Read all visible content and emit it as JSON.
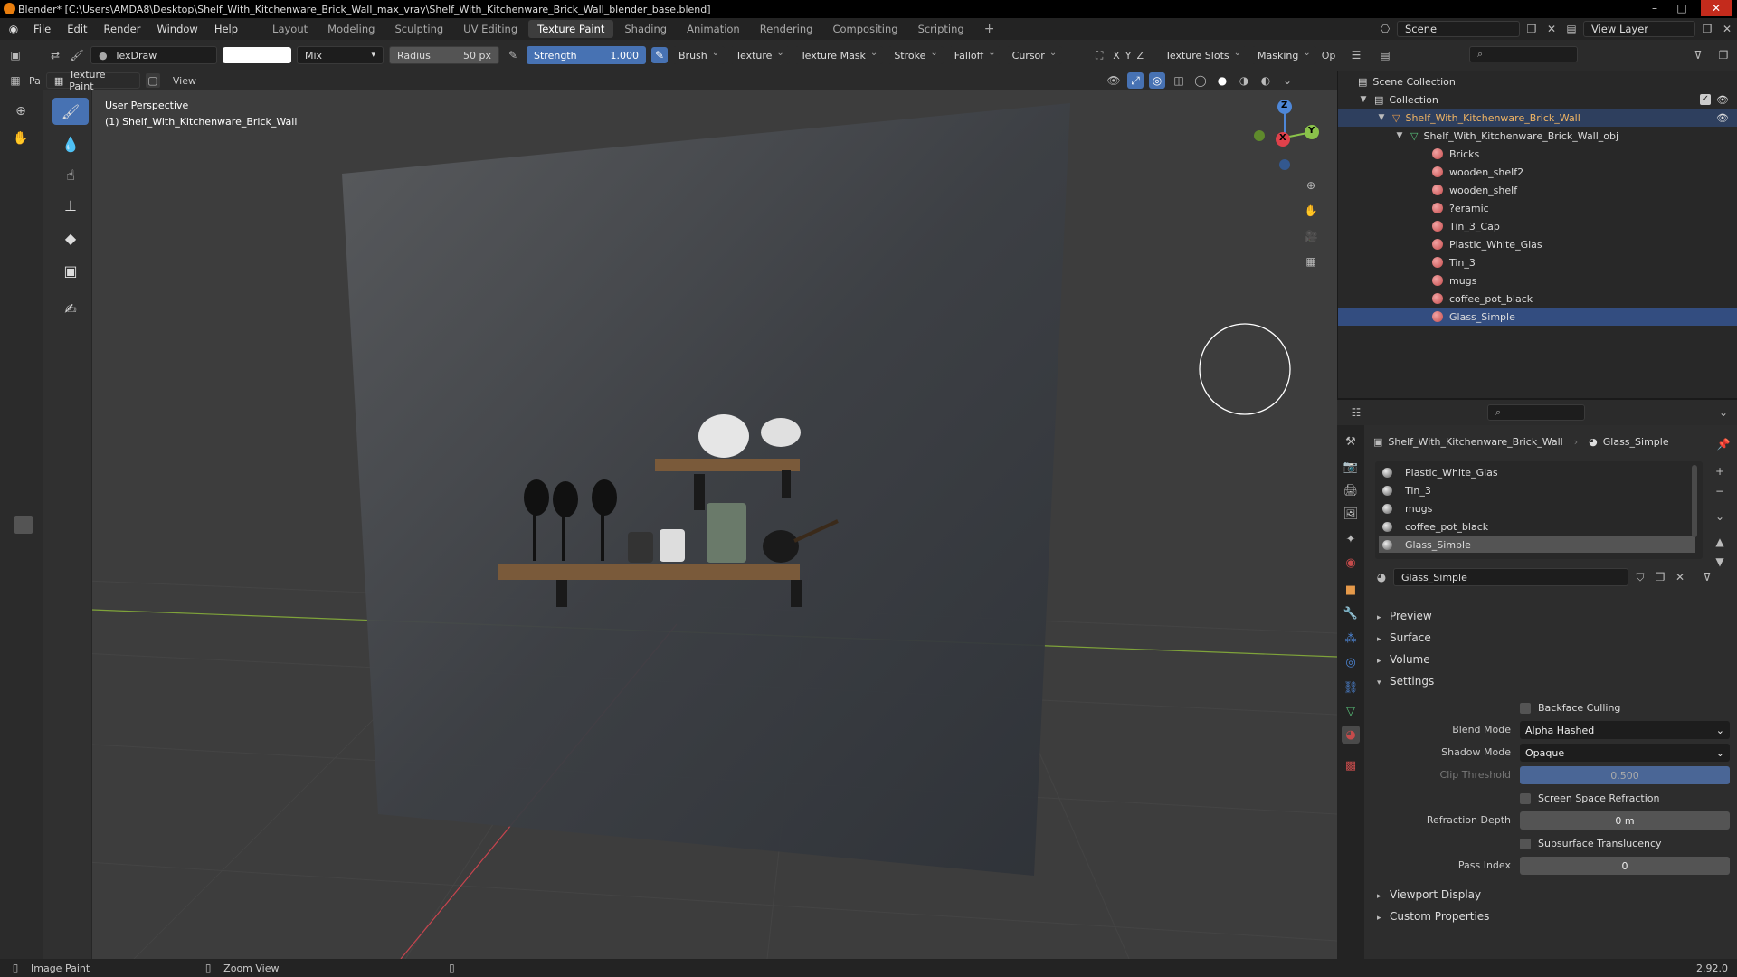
{
  "window": {
    "title": "Blender* [C:\\Users\\AMDA8\\Desktop\\Shelf_With_Kitchenware_Brick_Wall_max_vray\\Shelf_With_Kitchenware_Brick_Wall_blender_base.blend]",
    "controls": [
      "–",
      "□",
      "✕"
    ]
  },
  "menu": [
    "File",
    "Edit",
    "Render",
    "Window",
    "Help"
  ],
  "workspaces": [
    "Layout",
    "Modeling",
    "Sculpting",
    "UV Editing",
    "Texture Paint",
    "Shading",
    "Animation",
    "Rendering",
    "Compositing",
    "Scripting"
  ],
  "active_workspace": "Texture Paint",
  "scene": {
    "label": "Scene",
    "view_layer": "View Layer"
  },
  "toolbar": {
    "brush_name": "TexDraw",
    "blend": "Mix",
    "radius_label": "Radius",
    "radius_value": "50 px",
    "strength_label": "Strength",
    "strength_value": "1.000",
    "menus": [
      "Brush",
      "Texture",
      "Texture Mask",
      "Stroke",
      "Falloff",
      "Cursor"
    ],
    "axes": [
      "X",
      "Y",
      "Z"
    ],
    "texture_slots": "Texture Slots",
    "masking": "Masking",
    "options_cut": "Op"
  },
  "mode": {
    "pa": "Pa",
    "mode_name": "Texture Paint",
    "view": "View"
  },
  "viewport": {
    "perspective": "User Perspective",
    "object": "(1) Shelf_With_Kitchenware_Brick_Wall",
    "gizmo": {
      "z": "Z",
      "y": "Y",
      "x": "X"
    }
  },
  "outliner": {
    "scene_collection": "Scene Collection",
    "collection": "Collection",
    "object": "Shelf_With_Kitchenware_Brick_Wall",
    "mesh": "Shelf_With_Kitchenware_Brick_Wall_obj",
    "materials": [
      "Bricks",
      "wooden_shelf2",
      "wooden_shelf",
      "?eramic",
      "Tin_3_Cap",
      "Plastic_White_Glas",
      "Tin_3",
      "mugs",
      "coffee_pot_black",
      "Glass_Simple"
    ]
  },
  "properties": {
    "breadcrumb_object": "Shelf_With_Kitchenware_Brick_Wall",
    "breadcrumb_material": "Glass_Simple",
    "slots": [
      "Plastic_White_Glas",
      "Tin_3",
      "mugs",
      "coffee_pot_black",
      "Glass_Simple"
    ],
    "material_name": "Glass_Simple",
    "sections": {
      "preview": "Preview",
      "surface": "Surface",
      "volume": "Volume",
      "settings": "Settings",
      "viewport_display": "Viewport Display",
      "custom_properties": "Custom Properties"
    },
    "backface_culling": "Backface Culling",
    "blend_mode_label": "Blend Mode",
    "blend_mode": "Alpha Hashed",
    "shadow_mode_label": "Shadow Mode",
    "shadow_mode": "Opaque",
    "clip_threshold_label": "Clip Threshold",
    "clip_threshold": "0.500",
    "screen_space_refraction": "Screen Space Refraction",
    "refraction_depth_label": "Refraction Depth",
    "refraction_depth": "0 m",
    "subsurface_translucency": "Subsurface Translucency",
    "pass_index_label": "Pass Index",
    "pass_index": "0"
  },
  "status": {
    "left": "Image Paint",
    "middle": "Zoom View",
    "version": "2.92.0"
  },
  "colors": {
    "accent": "#4772b3",
    "selection": "#334d80",
    "x_axis": "#e0414b",
    "y_axis": "#8ac24a",
    "z_axis": "#4e87d8"
  }
}
